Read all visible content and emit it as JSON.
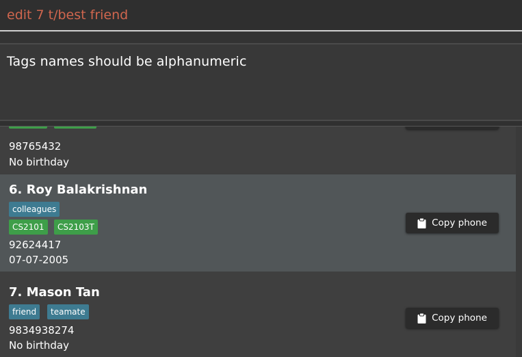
{
  "command_box": {
    "value": "edit 7 t/best friend"
  },
  "result_display": {
    "message": "Tags names should be alphanumeric"
  },
  "persons": [
    {
      "index": "",
      "name": "",
      "tags": [],
      "modules": [
        "",
        ""
      ],
      "phone": "98765432",
      "birthday": "No birthday"
    },
    {
      "index": "6.",
      "name": "6. Roy Balakrishnan",
      "tags": [
        "colleagues"
      ],
      "modules": [
        "CS2101",
        "CS2103T"
      ],
      "phone": "92624417",
      "birthday": "07-07-2005",
      "selected": true
    },
    {
      "index": "7.",
      "name": "7. Mason Tan",
      "tags": [
        "friend",
        "teamate"
      ],
      "modules": [],
      "phone": "9834938274",
      "birthday": "No birthday"
    }
  ],
  "copy_button_label": "Copy phone",
  "colors": {
    "tag_blue": "#3e7b91",
    "tag_green": "#3e9e49",
    "command_text": "#d0664e",
    "selected_card": "#515658"
  },
  "icons": {
    "copy": "clipboard-icon"
  }
}
